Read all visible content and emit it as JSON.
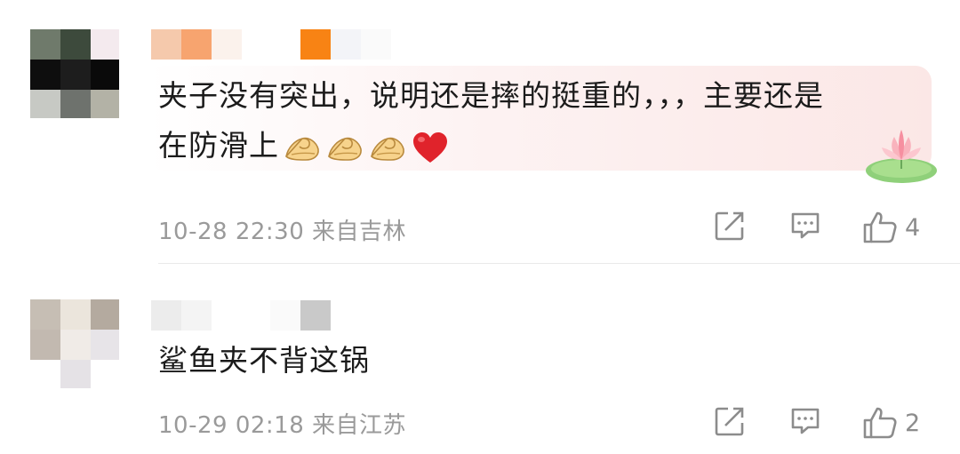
{
  "comments": [
    {
      "text_line1": "夹子没有突出，说明还是摔的挺重的，，，主要还是",
      "text_line2": "在防滑上",
      "emojis": [
        "ok-hand-icon",
        "ok-hand-icon",
        "ok-hand-icon",
        "red-heart-icon"
      ],
      "timestamp_location": "10-28 22:30 来自吉林",
      "like_count": "4",
      "has_lotus_sticker": true
    },
    {
      "text_line1": "鲨鱼夹不背这锅",
      "timestamp_location": "10-29 02:18 来自江苏",
      "like_count": "2"
    }
  ],
  "icons": {
    "share": "share-edit-icon",
    "reply": "comment-icon",
    "like": "thumbs-up-icon"
  },
  "colors": {
    "meta_text": "#9a9a9a",
    "heart": "#e0232b",
    "bubble_highlight": "#fbe7e6"
  }
}
